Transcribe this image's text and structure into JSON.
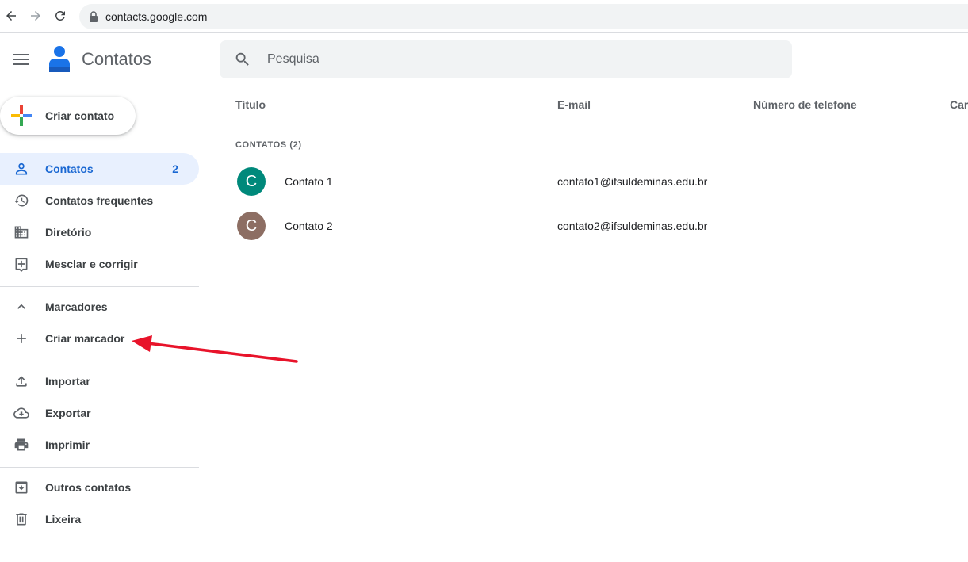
{
  "browser": {
    "url": "contacts.google.com"
  },
  "header": {
    "app_title": "Contatos",
    "search_placeholder": "Pesquisa"
  },
  "create_button": {
    "label": "Criar contato"
  },
  "sidebar": {
    "items": [
      {
        "label": "Contatos",
        "count": "2",
        "icon": "person-icon",
        "active": true
      },
      {
        "label": "Contatos frequentes",
        "icon": "history-icon"
      },
      {
        "label": "Diretório",
        "icon": "building-icon"
      },
      {
        "label": "Mesclar e corrigir",
        "icon": "merge-icon"
      }
    ],
    "labels_section": {
      "header": "Marcadores",
      "create_label": "Criar marcador"
    },
    "tools": [
      {
        "label": "Importar",
        "icon": "upload-icon"
      },
      {
        "label": "Exportar",
        "icon": "cloud-download-icon"
      },
      {
        "label": "Imprimir",
        "icon": "printer-icon"
      }
    ],
    "other": [
      {
        "label": "Outros contatos",
        "icon": "archive-icon"
      },
      {
        "label": "Lixeira",
        "icon": "trash-icon"
      }
    ]
  },
  "table": {
    "columns": [
      "Título",
      "E-mail",
      "Número de telefone",
      "Car"
    ],
    "section_label": "CONTATOS (2)",
    "rows": [
      {
        "initial": "C",
        "name": "Contato 1",
        "email": "contato1@ifsuldeminas.edu.br",
        "avatar_color": "#00897b"
      },
      {
        "initial": "C",
        "name": "Contato 2",
        "email": "contato2@ifsuldeminas.edu.br",
        "avatar_color": "#8d6e63"
      }
    ]
  },
  "colors": {
    "accent": "#1967d2",
    "active_bg": "#e8f0fe",
    "annotation_arrow": "#e8132a"
  }
}
